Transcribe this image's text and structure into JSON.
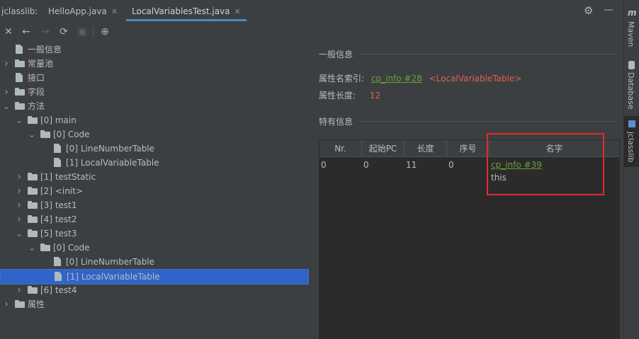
{
  "tabs": {
    "tool_title": "jclasslib:",
    "items": [
      {
        "label": "HelloApp.java",
        "active": false
      },
      {
        "label": "LocalVariablesTest.java",
        "active": true
      }
    ]
  },
  "toolbar": {
    "close": "✕",
    "back": "←",
    "forward": "→",
    "refresh": "⟳",
    "save": "▣",
    "web": "⊕"
  },
  "tree": [
    {
      "label": "一般信息",
      "depth": 0,
      "arrow": "",
      "icon": "file"
    },
    {
      "label": "常量池",
      "depth": 0,
      "arrow": "›",
      "icon": "folder"
    },
    {
      "label": "接口",
      "depth": 0,
      "arrow": "",
      "icon": "file"
    },
    {
      "label": "字段",
      "depth": 0,
      "arrow": "›",
      "icon": "folder"
    },
    {
      "label": "方法",
      "depth": 0,
      "arrow": "⌄",
      "icon": "folder"
    },
    {
      "label": "[0] main",
      "depth": 1,
      "arrow": "⌄",
      "icon": "folder"
    },
    {
      "label": "[0] Code",
      "depth": 2,
      "arrow": "⌄",
      "icon": "folder"
    },
    {
      "label": "[0] LineNumberTable",
      "depth": 3,
      "arrow": "",
      "icon": "file"
    },
    {
      "label": "[1] LocalVariableTable",
      "depth": 3,
      "arrow": "",
      "icon": "file"
    },
    {
      "label": "[1] testStatic",
      "depth": 1,
      "arrow": "›",
      "icon": "folder"
    },
    {
      "label": "[2] <init>",
      "depth": 1,
      "arrow": "›",
      "icon": "folder"
    },
    {
      "label": "[3] test1",
      "depth": 1,
      "arrow": "›",
      "icon": "folder"
    },
    {
      "label": "[4] test2",
      "depth": 1,
      "arrow": "›",
      "icon": "folder"
    },
    {
      "label": "[5] test3",
      "depth": 1,
      "arrow": "⌄",
      "icon": "folder"
    },
    {
      "label": "[0] Code",
      "depth": 2,
      "arrow": "⌄",
      "icon": "folder"
    },
    {
      "label": "[0] LineNumberTable",
      "depth": 3,
      "arrow": "",
      "icon": "file"
    },
    {
      "label": "[1] LocalVariableTable",
      "depth": 3,
      "arrow": "",
      "icon": "file",
      "selected": true
    },
    {
      "label": "[6] test4",
      "depth": 1,
      "arrow": "›",
      "icon": "folder"
    },
    {
      "label": "属性",
      "depth": 0,
      "arrow": "›",
      "icon": "folder"
    }
  ],
  "detail": {
    "general_title": "一般信息",
    "name_index_label": "属性名索引:",
    "name_index_link": "cp_info #28",
    "name_index_value": "<LocalVariableTable>",
    "length_label": "属性长度:",
    "length_value": "12",
    "specific_title": "特有信息",
    "table": {
      "headers": [
        "Nr.",
        "起始PC",
        "长度",
        "序号",
        "名字"
      ],
      "rows": [
        {
          "nr": "0",
          "start_pc": "0",
          "length": "11",
          "index": "0",
          "name_link": "cp_info #39",
          "name_text": "this"
        }
      ]
    }
  },
  "sidebar": {
    "tabs": [
      "Maven",
      "Database",
      "jclasslib"
    ]
  },
  "colors": {
    "background": "#3c3f41",
    "selection": "#2f65ca",
    "link": "#6a9f3a",
    "value_red": "#e05f55",
    "highlight_box": "#e52a2a"
  }
}
